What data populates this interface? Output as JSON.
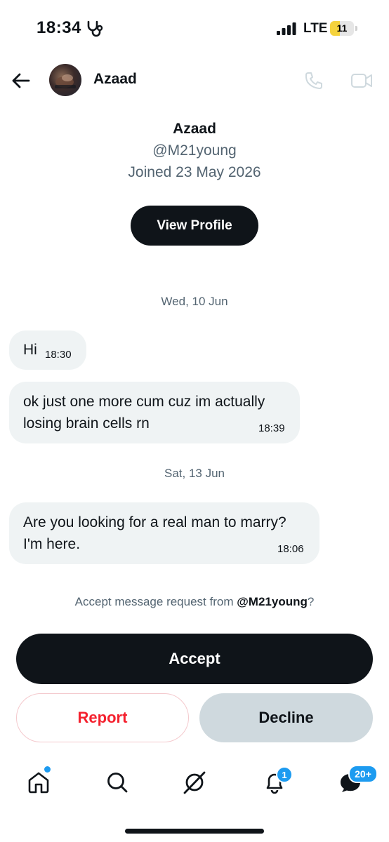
{
  "status_bar": {
    "time": "18:34",
    "network": "LTE",
    "battery_level": "11"
  },
  "header": {
    "name": "Azaad"
  },
  "profile": {
    "name": "Azaad",
    "handle": "@M21young",
    "joined": "Joined 23 May 2026",
    "view_profile_label": "View Profile"
  },
  "conversation": {
    "groups": [
      {
        "date": "Wed, 10 Jun",
        "messages": [
          {
            "lines": [
              "Hi"
            ],
            "time": "18:30"
          },
          {
            "lines": [
              "ok just one more cum cuz im actually",
              "losing brain cells rn"
            ],
            "time": "18:39"
          }
        ]
      },
      {
        "date": "Sat, 13 Jun",
        "messages": [
          {
            "lines": [
              "Are you looking for a real man to marry?",
              "I'm here."
            ],
            "time": "18:06"
          }
        ]
      }
    ]
  },
  "request": {
    "prefix": "Accept message request from ",
    "handle": "@M21young",
    "suffix": "?",
    "accept_label": "Accept",
    "report_label": "Report",
    "decline_label": "Decline"
  },
  "bottom_nav": {
    "items": [
      "home-icon",
      "search-icon",
      "grok-icon",
      "notifications-icon",
      "messages-icon"
    ],
    "notifications_badge": "1",
    "messages_badge": "20+"
  },
  "colors": {
    "accent": "#1d9bf0",
    "danger": "#f4212e",
    "dark": "#0f1419",
    "muted": "#536471",
    "bubble": "#eff3f4"
  }
}
